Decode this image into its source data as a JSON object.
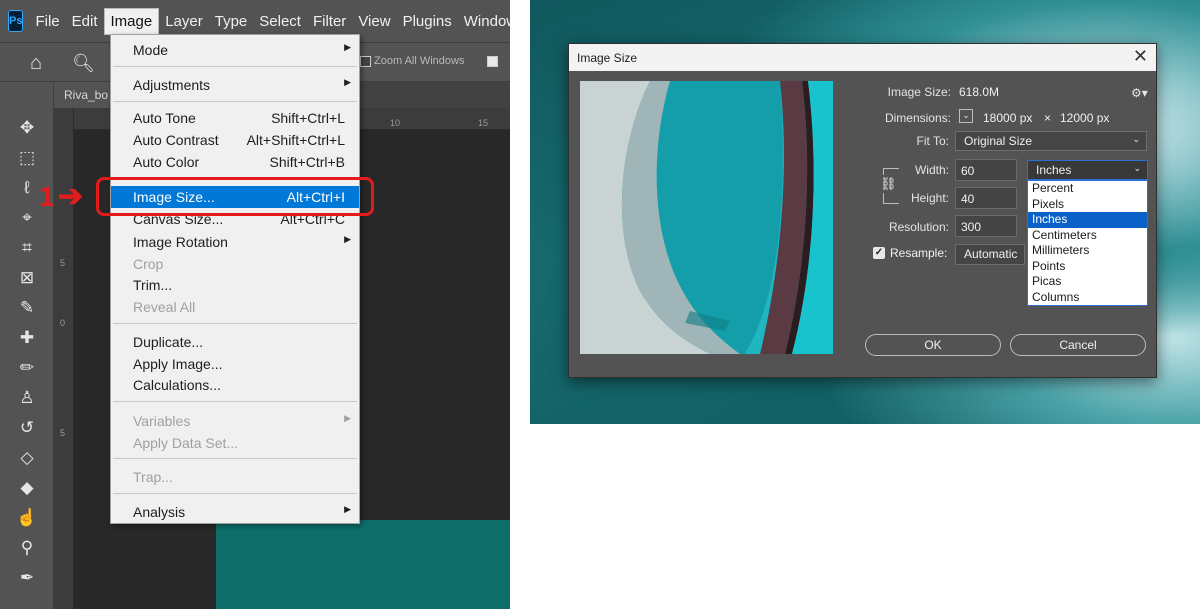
{
  "photoshop": {
    "logo": "Ps",
    "menubar": [
      "File",
      "Edit",
      "Image",
      "Layer",
      "Type",
      "Select",
      "Filter",
      "View",
      "Plugins",
      "Window"
    ],
    "options": {
      "zoom_all_windows": "Zoom All Windows"
    },
    "document_tab": "Riva_bo",
    "ruler_top": [
      "10",
      "15"
    ],
    "ruler_left": [
      "5",
      "0",
      "5"
    ],
    "image_menu": {
      "items": [
        {
          "label": "Mode",
          "submenu": true
        },
        {
          "label": "Adjustments",
          "submenu": true
        },
        {
          "label": "Auto Tone",
          "shortcut": "Shift+Ctrl+L"
        },
        {
          "label": "Auto Contrast",
          "shortcut": "Alt+Shift+Ctrl+L"
        },
        {
          "label": "Auto Color",
          "shortcut": "Shift+Ctrl+B"
        },
        {
          "label": "Image Size...",
          "shortcut": "Alt+Ctrl+I",
          "highlighted": true
        },
        {
          "label": "Canvas Size...",
          "shortcut": "Alt+Ctrl+C"
        },
        {
          "label": "Image Rotation",
          "submenu": true
        },
        {
          "label": "Crop",
          "disabled": true
        },
        {
          "label": "Trim..."
        },
        {
          "label": "Reveal All",
          "disabled": true
        },
        {
          "label": "Duplicate..."
        },
        {
          "label": "Apply Image..."
        },
        {
          "label": "Calculations..."
        },
        {
          "label": "Variables",
          "submenu": true,
          "disabled": true
        },
        {
          "label": "Apply Data Set...",
          "disabled": true
        },
        {
          "label": "Trap...",
          "disabled": true
        },
        {
          "label": "Analysis",
          "submenu": true
        }
      ]
    },
    "annotation": {
      "step": "1",
      "arrow": "➔",
      "color": "#e31b1b"
    },
    "highlight_color": "#0078d7"
  },
  "image_size_dialog": {
    "title": "Image Size",
    "image_size_label": "Image Size:",
    "image_size_value": "618.0M",
    "dimensions_label": "Dimensions:",
    "dimensions_width": "18000 px",
    "dimensions_times": "×",
    "dimensions_height": "12000 px",
    "fit_to_label": "Fit To:",
    "fit_to_value": "Original Size",
    "width_label": "Width:",
    "width_value": "60",
    "height_label": "Height:",
    "height_value": "40",
    "resolution_label": "Resolution:",
    "resolution_value": "300",
    "resample_label": "Resample:",
    "resample_checked": true,
    "resample_value": "Automatic",
    "unit_selected": "Inches",
    "unit_options": [
      "Percent",
      "Pixels",
      "Inches",
      "Centimeters",
      "Millimeters",
      "Points",
      "Picas",
      "Columns"
    ],
    "ok_label": "OK",
    "cancel_label": "Cancel"
  }
}
